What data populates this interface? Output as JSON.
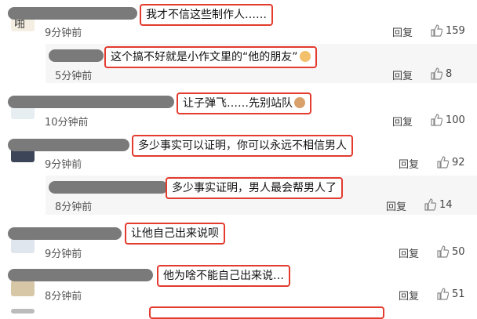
{
  "comments": [
    {
      "text": "我才不信这些制作人……",
      "time": "9分钟前",
      "reply": "回复",
      "likes": "159"
    },
    {
      "text": "这个搞不好就是小作文里的“他的朋友”",
      "time": "5分钟前",
      "reply": "回复",
      "likes": "8"
    },
    {
      "text": "让子弹飞……先别站队",
      "time": "10分钟前",
      "reply": "回复",
      "likes": "100"
    },
    {
      "text": "多少事实可以证明，你可以永远不相信男人",
      "time": "9分钟前",
      "reply": "回复",
      "likes": "92"
    },
    {
      "text": "多少事实证明，男人最会帮男人了",
      "time": "8分钟前",
      "reply": "回复",
      "likes": "14"
    },
    {
      "text": "让他自己出来说呗",
      "time": "9分钟前",
      "reply": "回复",
      "likes": "50"
    },
    {
      "text": "他为啥不能自己出来说…",
      "time": "8分钟前",
      "reply": "回复",
      "likes": "51"
    }
  ],
  "avatar_text": "啪",
  "colors": {
    "highlight": "#e33b2e",
    "name_blur": "#7a7a7a"
  },
  "icons": {
    "like": "thumbs-up-icon",
    "emoji": "face-emoji-icon"
  }
}
